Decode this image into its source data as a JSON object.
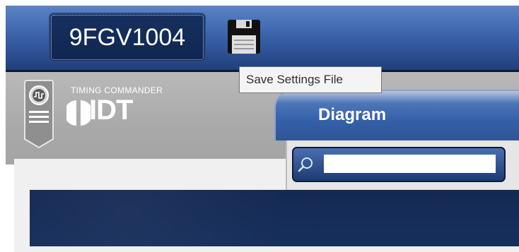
{
  "header": {
    "device_name": "9FGV1004",
    "save_icon": "floppy-disk-icon"
  },
  "tooltip": {
    "text": "Save Settings File"
  },
  "brand": {
    "product_name": "TIMING COMMANDER",
    "company": "IDT",
    "logo_icon": "oscilloscope-clock-icon"
  },
  "tabs": [
    {
      "label": "Diagram",
      "active": true
    }
  ],
  "search": {
    "value": "",
    "placeholder": "",
    "icon": "search-icon"
  },
  "colors": {
    "header_blue": "#3f67ae",
    "dark_navy": "#142a54",
    "panel_gray": "#b0b0b0"
  }
}
